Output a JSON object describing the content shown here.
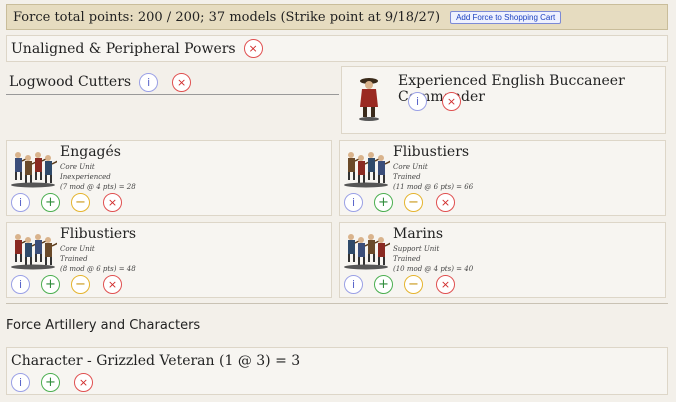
{
  "header": {
    "title": "Force total points: 200 / 200; 37 models (Strike point at 9/18/27)",
    "cart_button": "Add Force to Shopping Cart"
  },
  "unaligned": {
    "title": "Unaligned & Peripheral Powers",
    "delete": "×"
  },
  "logwood": {
    "title": "Logwood Cutters",
    "info": "i",
    "delete": "×"
  },
  "commander": {
    "title": "Experienced English Buccaneer Commander",
    "info": "i",
    "delete": "×"
  },
  "units": [
    {
      "name": "Engagés",
      "type": "Core Unit",
      "quality": "Inexperienced",
      "cost": "(7 mod @ 4 pts) = 28",
      "has_sub": true
    },
    {
      "name": "Flibustiers",
      "type": "Core Unit",
      "quality": "Trained",
      "cost": "(11 mod @ 6 pts) = 66",
      "has_sub": true
    },
    {
      "name": "Flibustiers",
      "type": "Core Unit",
      "quality": "Trained",
      "cost": "(8 mod @ 6 pts) = 48",
      "has_sub": true
    },
    {
      "name": "Marins",
      "type": "Support Unit",
      "quality": "Trained",
      "cost": "(10 mod @ 4 pts) = 40",
      "has_sub": true
    }
  ],
  "buttons": {
    "info": "i",
    "add": "+",
    "sub": "−",
    "del": "×"
  },
  "artillery": {
    "section_title": "Force Artillery and Characters",
    "character": "Character - Grizzled Veteran (1 @ 3) = 3"
  }
}
